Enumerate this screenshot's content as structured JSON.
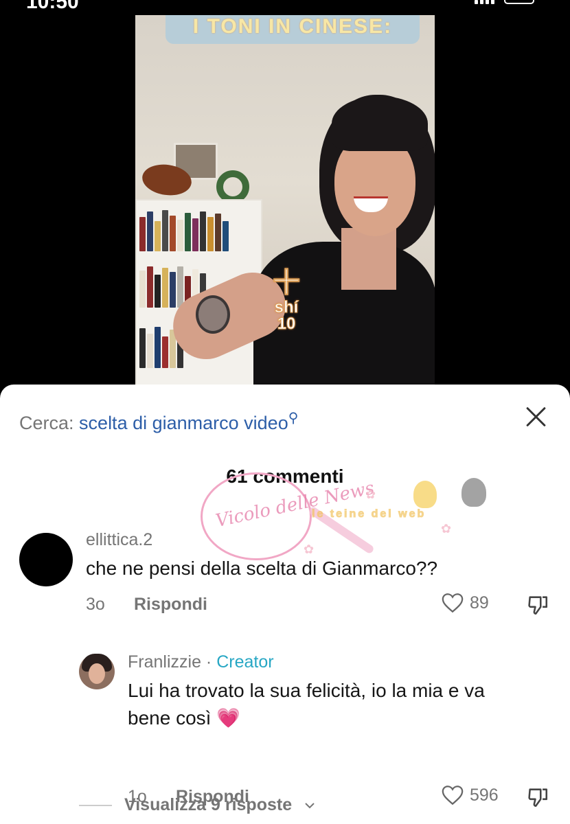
{
  "status_bar": {
    "time": "10:50"
  },
  "video": {
    "banner_text": "I TONI IN CINESE:",
    "overlay_char": "十",
    "overlay_pinyin": "shí",
    "overlay_number": "10"
  },
  "comments_sheet": {
    "search_label": "Cerca:",
    "search_query": "scelta di gianmarco video",
    "comments_count": "61 commenti",
    "watermark_text": "Vicolo delle News",
    "watermark_band": "le teine del web",
    "comments": [
      {
        "username": "ellittica.2",
        "text": "che ne pensi della scelta di Gianmarco??",
        "age": "3o",
        "reply_label": "Rispondi",
        "likes": "89"
      },
      {
        "username": "Franlizzie",
        "separator": " · ",
        "badge": "Creator",
        "text_line1": "Lui ha trovato la sua felicità, io la mia e va",
        "text_line2": "bene così",
        "emoji": "💗",
        "age": "1o",
        "reply_label": "Rispondi",
        "likes": "596"
      }
    ],
    "view_replies": "Visualizza 9 risposte"
  },
  "colors": {
    "creator_badge": "#27a7c4",
    "search_query": "#2d5ea8",
    "heart_emoji": "#f0609a"
  }
}
